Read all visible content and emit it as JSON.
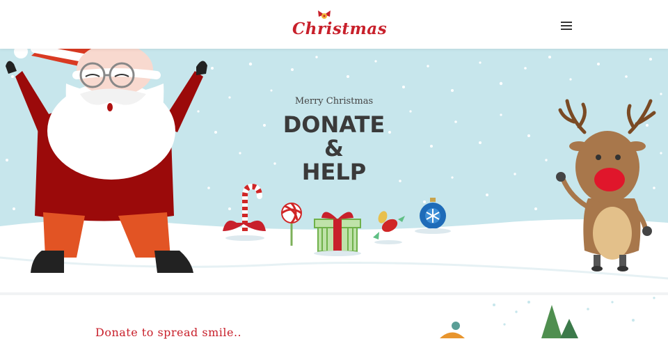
{
  "header": {
    "logo_text": "Christmas",
    "menu_icon": "hamburger-menu-icon"
  },
  "hero": {
    "subtitle": "Merry Christmas",
    "title_lines": [
      "DONATE",
      "&",
      "HELP"
    ]
  },
  "section": {
    "heading": "Donate to spread smile.."
  },
  "colors": {
    "brand_red": "#c8202b",
    "sky": "#c7e6ec",
    "snow": "#ffffff",
    "title_text": "#3a3a3a"
  }
}
